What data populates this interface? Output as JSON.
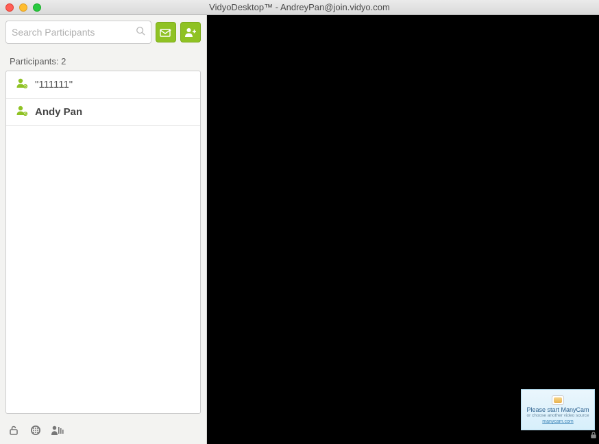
{
  "window": {
    "title": "VidyoDesktop™ - AndreyPan@join.vidyo.com"
  },
  "search": {
    "placeholder": "Search Participants"
  },
  "participants": {
    "label": "Participants: 2",
    "items": [
      {
        "name": "\"111111\"",
        "bold": false
      },
      {
        "name": "Andy Pan",
        "bold": true
      }
    ]
  },
  "pip": {
    "line1": "Please start ManyCam",
    "line2": "or choose another video source",
    "line3": "manycam.com"
  }
}
